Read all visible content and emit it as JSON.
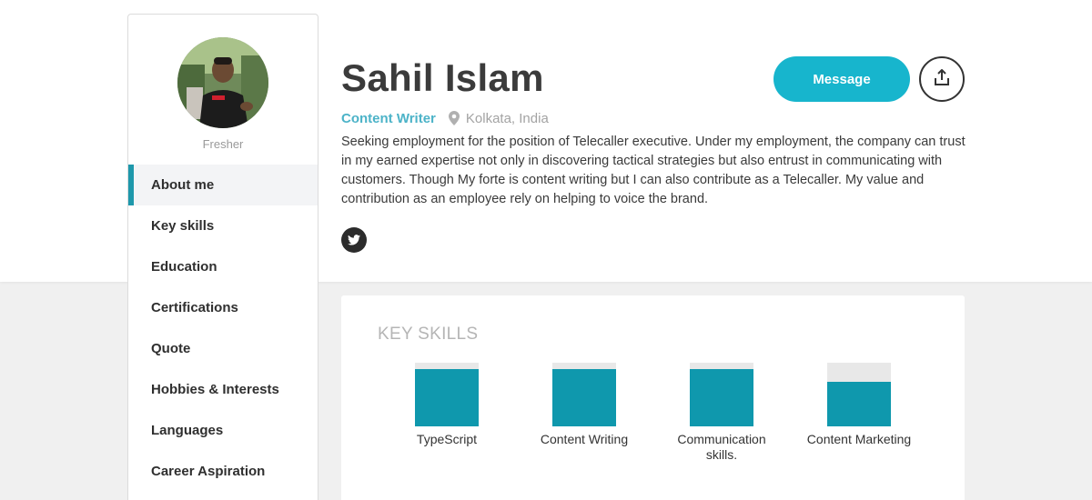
{
  "profile": {
    "name": "Sahil Islam",
    "role": "Content Writer",
    "location": "Kolkata, India",
    "status": "Fresher",
    "bio": "Seeking employment for the position of Telecaller executive. Under my employment, the company can trust in my earned expertise not only in discovering tactical strategies but also entrust in communicating with customers. Though My forte is content writing but I can also contribute as a Telecaller. My value and contribution as an employee rely on helping to voice the brand."
  },
  "actions": {
    "message_label": "Message",
    "share_icon": "share-icon"
  },
  "social": {
    "twitter_icon": "twitter-icon"
  },
  "sidebar": {
    "items": [
      {
        "label": "About me",
        "active": true
      },
      {
        "label": "Key skills",
        "active": false
      },
      {
        "label": "Education",
        "active": false
      },
      {
        "label": "Certifications",
        "active": false
      },
      {
        "label": "Quote",
        "active": false
      },
      {
        "label": "Hobbies & Interests",
        "active": false
      },
      {
        "label": "Languages",
        "active": false
      },
      {
        "label": "Career Aspiration",
        "active": false
      }
    ]
  },
  "skills": {
    "title": "KEY SKILLS",
    "items": [
      {
        "label": "TypeScript",
        "level": 0.9
      },
      {
        "label": "Content Writing",
        "level": 0.9
      },
      {
        "label": "Communication skills.",
        "level": 0.9
      },
      {
        "label": "Content Marketing",
        "level": 0.7
      }
    ]
  },
  "colors": {
    "accent": "#17b5cd",
    "bar_fill": "#0f98ad",
    "role_text": "#4cb3c8",
    "active_indicator": "#1e98ab"
  }
}
